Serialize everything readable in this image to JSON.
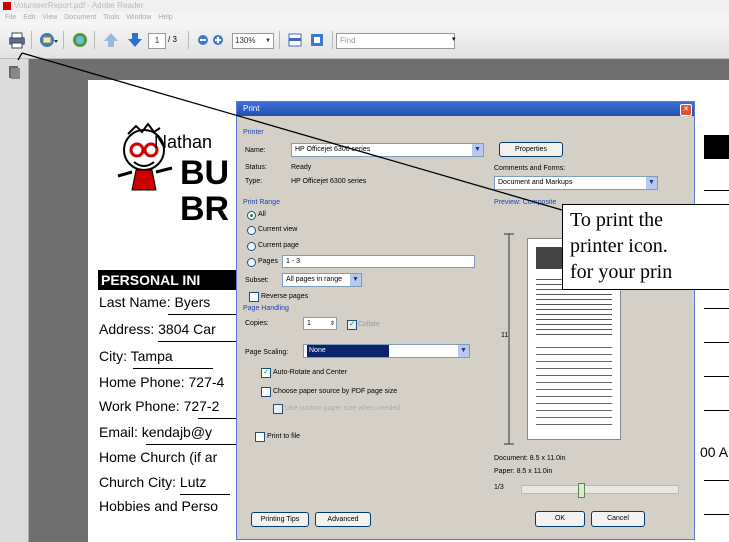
{
  "app": {
    "window_title": "VolunteerReport.pdf - Adobe Reader",
    "menu": [
      "File",
      "Edit",
      "View",
      "Document",
      "Tools",
      "Window",
      "Help"
    ]
  },
  "toolbar": {
    "page_current": "1",
    "page_total": "/ 3",
    "zoom": "130%",
    "find_placeholder": "Find",
    "icons": [
      "printer-icon",
      "email-icon",
      "hand-icon",
      "prev-page-icon",
      "next-page-icon",
      "zoom-out-icon",
      "zoom-in-icon",
      "fit-page-icon",
      "full-screen-icon"
    ]
  },
  "document": {
    "header_text": "Nathan",
    "logo_letters_1": "BU",
    "logo_letters_2": "BR",
    "section_title": "PERSONAL INI",
    "fields": [
      {
        "label": "Last Name:",
        "value": "Byers"
      },
      {
        "label": "Address:",
        "value": "3804 Car"
      },
      {
        "label": "City:",
        "value": "Tampa"
      },
      {
        "label": "Home Phone:",
        "value": "727-4"
      },
      {
        "label": "Work Phone:",
        "value": "727-2"
      },
      {
        "label": "Email:",
        "value": "kendajb@y"
      },
      {
        "label": "Home Church (if ar",
        "value": ""
      },
      {
        "label": "Church City:",
        "value": "Lutz"
      },
      {
        "label": "Hobbies and Perso",
        "value": ""
      }
    ],
    "right_edge_text": "00 A"
  },
  "print_dialog": {
    "title": "Print",
    "printer_section": "Printer",
    "name_label": "Name:",
    "printer_name": "HP Officejet 6300 series",
    "status_label": "Status:",
    "status_value": "Ready",
    "type_label": "Type:",
    "type_value": "HP Officejet 6300 series",
    "properties_button": "Properties",
    "comments_label": "Comments and Forms:",
    "comments_value": "Document and Markups",
    "print_range_section": "Print Range",
    "range_all": "All",
    "range_current_view": "Current view",
    "range_current_page": "Current page",
    "range_pages": "Pages",
    "pages_value": "1 - 3",
    "subset_label": "Subset:",
    "subset_value": "All pages in range",
    "reverse_pages": "Reverse pages",
    "page_handling_section": "Page Handling",
    "copies_label": "Copies:",
    "copies_value": "1",
    "collate": "Collate",
    "page_scaling_label": "Page Scaling:",
    "page_scaling_value": "None",
    "auto_rotate": "Auto-Rotate and Center",
    "choose_paper": "Choose paper source by PDF page size",
    "custom_paper": "Use custom paper size when needed",
    "print_to_file": "Print to file",
    "preview_label": "Preview: Composite",
    "preview_dim": "11",
    "document_size": "Document: 8.5 x 11.0in",
    "paper_size": "Paper: 8.5 x 11.0in",
    "page_indicator": "1/3",
    "printing_tips_button": "Printing Tips",
    "advanced_button": "Advanced",
    "ok_button": "OK",
    "cancel_button": "Cancel"
  },
  "callout": {
    "line1": "To print the",
    "line2": "printer icon.",
    "line3": "for your prin"
  }
}
